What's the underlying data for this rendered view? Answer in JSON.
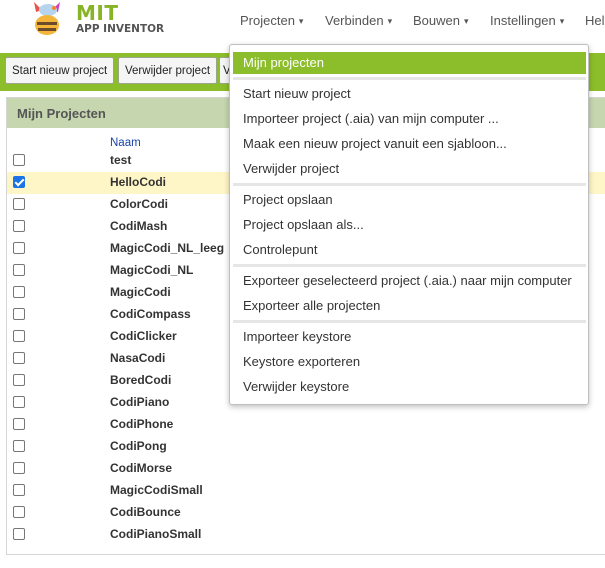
{
  "app": {
    "logo_mit": "MIT",
    "logo_sub": "APP INVENTOR"
  },
  "nav": {
    "items": [
      {
        "label": "Projecten"
      },
      {
        "label": "Verbinden"
      },
      {
        "label": "Bouwen"
      },
      {
        "label": "Instellingen"
      },
      {
        "label": "Help"
      }
    ],
    "caret": "▾"
  },
  "toolbar": {
    "new_project_label": "Start nieuw project",
    "delete_project_label": "Verwijder project",
    "partial_label": "V"
  },
  "panel": {
    "title": "Mijn Projecten",
    "column_name": "Naam",
    "projects": [
      {
        "name": "test",
        "checked": false
      },
      {
        "name": "HelloCodi",
        "checked": true
      },
      {
        "name": "ColorCodi",
        "checked": false
      },
      {
        "name": "CodiMash",
        "checked": false
      },
      {
        "name": "MagicCodi_NL_leeg",
        "checked": false
      },
      {
        "name": "MagicCodi_NL",
        "checked": false
      },
      {
        "name": "MagicCodi",
        "checked": false
      },
      {
        "name": "CodiCompass",
        "checked": false
      },
      {
        "name": "CodiClicker",
        "checked": false
      },
      {
        "name": "NasaCodi",
        "checked": false
      },
      {
        "name": "BoredCodi",
        "checked": false
      },
      {
        "name": "CodiPiano",
        "checked": false
      },
      {
        "name": "CodiPhone",
        "checked": false
      },
      {
        "name": "CodiPong",
        "checked": false
      },
      {
        "name": "CodiMorse",
        "checked": false
      },
      {
        "name": "MagicCodiSmall",
        "checked": false
      },
      {
        "name": "CodiBounce",
        "checked": false
      },
      {
        "name": "CodiPianoSmall",
        "checked": false
      }
    ]
  },
  "menu": {
    "groups": [
      [
        "Mijn projecten"
      ],
      [
        "Start nieuw project",
        "Importeer project (.aia) van mijn computer ...",
        "Maak een nieuw project vanuit een sjabloon...",
        "Verwijder project"
      ],
      [
        "Project opslaan",
        "Project opslaan als...",
        "Controlepunt"
      ],
      [
        "Exporteer geselecteerd project (.aia.) naar mijn computer",
        "Exporteer alle projecten"
      ],
      [
        "Importeer keystore",
        "Keystore exporteren",
        "Verwijder keystore"
      ]
    ]
  },
  "colors": {
    "brand_green": "#8cbd2a",
    "panel_header": "#c6d7b0",
    "selected_row": "#fff6c7",
    "link_blue": "#1a44a8"
  }
}
